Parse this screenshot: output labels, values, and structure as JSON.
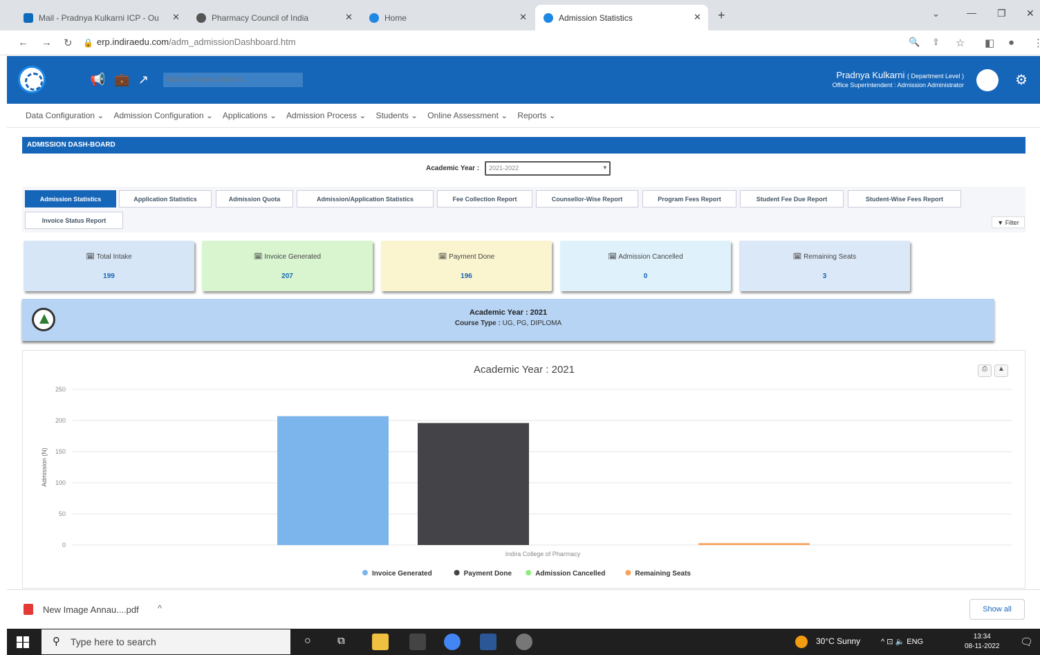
{
  "browser": {
    "tabs": [
      {
        "title": "Mail - Pradnya Kulkarni ICP - Ou",
        "color": "#0f6cbd"
      },
      {
        "title": "Pharmacy Council of India",
        "color": "#555555"
      },
      {
        "title": "Home",
        "color": "#1e88e5"
      },
      {
        "title": "Admission Statistics",
        "color": "#1e88e5"
      }
    ],
    "url_host": "erp.indiraedu.com",
    "url_path": "/adm_admissionDashboard.htm"
  },
  "header": {
    "search_placeholder": "Module, Pages, Deck etc...",
    "user_name": "Pradnya Kulkarni",
    "user_level": "( Department Level )",
    "user_role": "Office Superintendent : Admission Administrator"
  },
  "menu": [
    "Data Configuration ⌄",
    "Admission Configuration ⌄",
    "Applications ⌄",
    "Admission Process ⌄",
    "Students ⌄",
    "Online Assessment ⌄",
    "Reports ⌄"
  ],
  "dashboard": {
    "title": "ADMISSION DASH-BOARD",
    "academic_year_label": "Academic Year :",
    "academic_year_value": "2021-2022",
    "report_tabs": [
      "Admission Statistics",
      "Application Statistics",
      "Admission Quota",
      "Admission/Application Statistics",
      "Fee Collection Report",
      "Counsellor-Wise Report",
      "Program Fees Report",
      "Student Fee Due Report",
      "Student-Wise Fees Report",
      "Invoice Status Report"
    ],
    "filter_label": "▼ Filter",
    "cards": [
      {
        "label": "🗓 Total Intake",
        "value": "199",
        "color": "#d7e6f7"
      },
      {
        "label": "🗓 Invoice Generated",
        "value": "207",
        "color": "#d9f5cf"
      },
      {
        "label": "🗓 Payment Done",
        "value": "196",
        "color": "#fbf5cf"
      },
      {
        "label": "🗓 Admission Cancelled",
        "value": "0",
        "color": "#dff1fb"
      },
      {
        "label": "🗓 Remaining Seats",
        "value": "3",
        "color": "#dbe8f8"
      }
    ],
    "info": {
      "year_line": "Academic Year : 2021",
      "course_label": "Course Type :",
      "course_value": "UG, PG, DIPLOMA"
    }
  },
  "chart_data": {
    "type": "bar",
    "title": "Academic Year : 2021",
    "ylabel": "Admission (N)",
    "categories": [
      "Indira College of Pharmacy"
    ],
    "ylim": [
      0,
      250
    ],
    "yticks": [
      0,
      50,
      100,
      150,
      200,
      250
    ],
    "grid": true,
    "legend_position": "bottom",
    "series": [
      {
        "name": "Invoice Generated",
        "values": [
          207
        ],
        "color": "#7cb5ec"
      },
      {
        "name": "Payment Done",
        "values": [
          196
        ],
        "color": "#434348"
      },
      {
        "name": "Admission Cancelled",
        "values": [
          0
        ],
        "color": "#90ed7d"
      },
      {
        "name": "Remaining Seats",
        "values": [
          3
        ],
        "color": "#f7a35c"
      }
    ]
  },
  "download": {
    "file": "New Image Annau....pdf",
    "show_all": "Show all"
  },
  "taskbar": {
    "search_text": "Type here to search",
    "weather": "30°C  Sunny",
    "tray": "^  ⊡  🔈  ENG",
    "time": "13:34",
    "date": "08-11-2022"
  }
}
